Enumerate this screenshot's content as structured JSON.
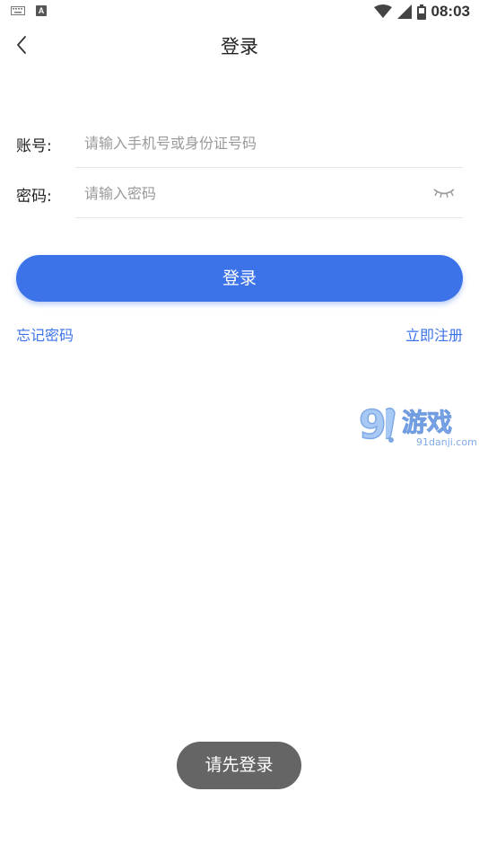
{
  "status_bar": {
    "time": "08:03",
    "icons": [
      "keyboard-icon",
      "a-notification-icon",
      "wifi-icon",
      "signal-icon",
      "battery-icon"
    ]
  },
  "nav": {
    "back_icon": "chevron-left-icon",
    "title": "登录"
  },
  "form": {
    "account": {
      "label": "账号:",
      "value": "",
      "placeholder": "请输入手机号或身份证号码"
    },
    "password": {
      "label": "密码:",
      "value": "",
      "placeholder": "请输入密码",
      "toggle_icon": "eye-closed-icon"
    }
  },
  "actions": {
    "login_label": "登录",
    "forgot_password": "忘记密码",
    "register": "立即注册"
  },
  "watermark": {
    "logo_main": "9",
    "logo_text": "游戏",
    "domain": "91danji.com"
  },
  "toast": {
    "message": "请先登录"
  },
  "colors": {
    "accent": "#3d73e8",
    "toast_bg": "#505050",
    "placeholder": "#9a9a9a",
    "divider": "#e6e6e6"
  }
}
